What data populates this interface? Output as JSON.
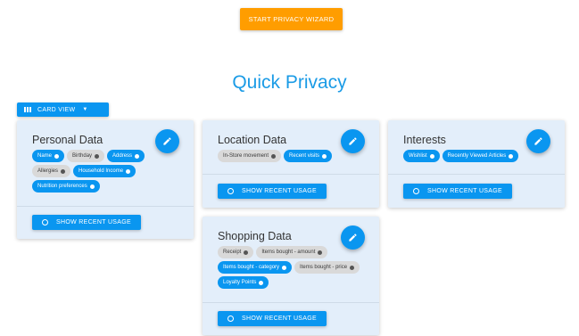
{
  "wizard_button": "START PRIVACY WIZARD",
  "page_title": "Quick Privacy",
  "view_button": "CARD VIEW",
  "usage_label": "SHOW RECENT USAGE",
  "accent_color": "#0a96f0",
  "wizard_color": "#ff9d00",
  "cards": {
    "personal": {
      "title": "Personal Data",
      "chips": [
        {
          "label": "Name",
          "active": true
        },
        {
          "label": "Birthday",
          "active": false
        },
        {
          "label": "Address",
          "active": true
        },
        {
          "label": "Allergies",
          "active": false
        },
        {
          "label": "Household Income",
          "active": true
        },
        {
          "label": "Nutrition preferences",
          "active": true
        }
      ]
    },
    "location": {
      "title": "Location Data",
      "chips": [
        {
          "label": "In-Store movement",
          "active": false
        },
        {
          "label": "Recent visits",
          "active": true
        }
      ]
    },
    "interests": {
      "title": "Interests",
      "chips": [
        {
          "label": "Wishlist",
          "active": true
        },
        {
          "label": "Recently Viewed Articles",
          "active": true
        }
      ]
    },
    "shopping": {
      "title": "Shopping Data",
      "chips": [
        {
          "label": "Receipt",
          "active": false
        },
        {
          "label": "Items bought - amount",
          "active": false
        },
        {
          "label": "Items bought - category",
          "active": true
        },
        {
          "label": "Items bought - price",
          "active": false
        },
        {
          "label": "Loyalty Points",
          "active": true
        }
      ]
    }
  }
}
